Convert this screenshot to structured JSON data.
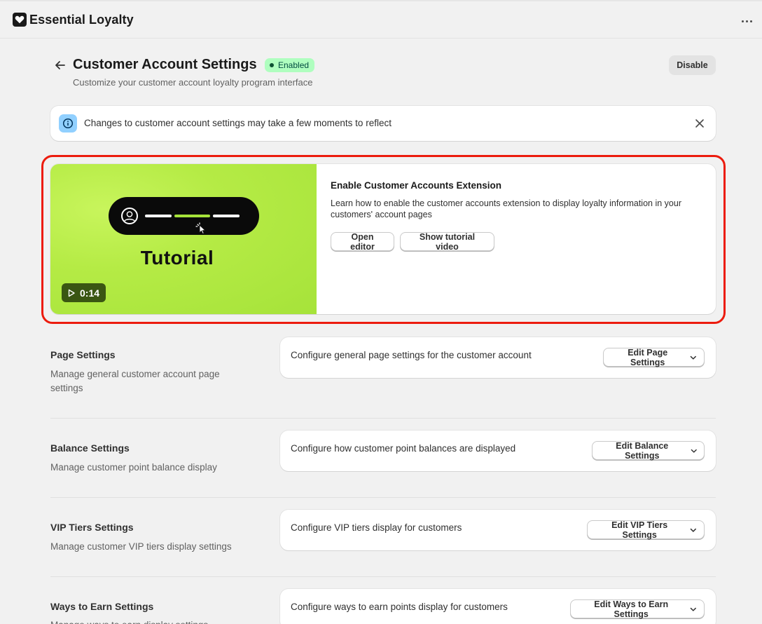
{
  "app": {
    "title": "Essential Loyalty"
  },
  "header": {
    "title": "Customer Account Settings",
    "status_badge": "Enabled",
    "subtitle": "Customize your customer account loyalty program interface",
    "disable_label": "Disable"
  },
  "banner": {
    "message": "Changes to customer account settings may take a few moments to reflect"
  },
  "tutorial": {
    "thumbnail_label": "Tutorial",
    "duration": "0:14",
    "heading": "Enable Customer Accounts Extension",
    "description": "Learn how to enable the customer accounts extension to display loyalty information in your customers' account pages",
    "open_editor_label": "Open editor",
    "show_video_label": "Show tutorial video"
  },
  "sections": [
    {
      "title": "Page Settings",
      "description": "Manage general customer account page settings",
      "card_text": "Configure general page settings for the customer account",
      "button_label": "Edit Page Settings"
    },
    {
      "title": "Balance Settings",
      "description": "Manage customer point balance display",
      "card_text": "Configure how customer point balances are displayed",
      "button_label": "Edit Balance Settings"
    },
    {
      "title": "VIP Tiers Settings",
      "description": "Manage customer VIP tiers display settings",
      "card_text": "Configure VIP tiers display for customers",
      "button_label": "Edit VIP Tiers Settings"
    },
    {
      "title": "Ways to Earn Settings",
      "description": "Manage ways to earn display settings",
      "card_text": "Configure ways to earn points display for customers",
      "button_label": "Edit Ways to Earn Settings"
    }
  ],
  "colors": {
    "highlight": "#ec1c0e",
    "badge_bg": "#affebf",
    "thumbnail_green": "#b5eb45",
    "info_blue": "#91d0ff"
  }
}
